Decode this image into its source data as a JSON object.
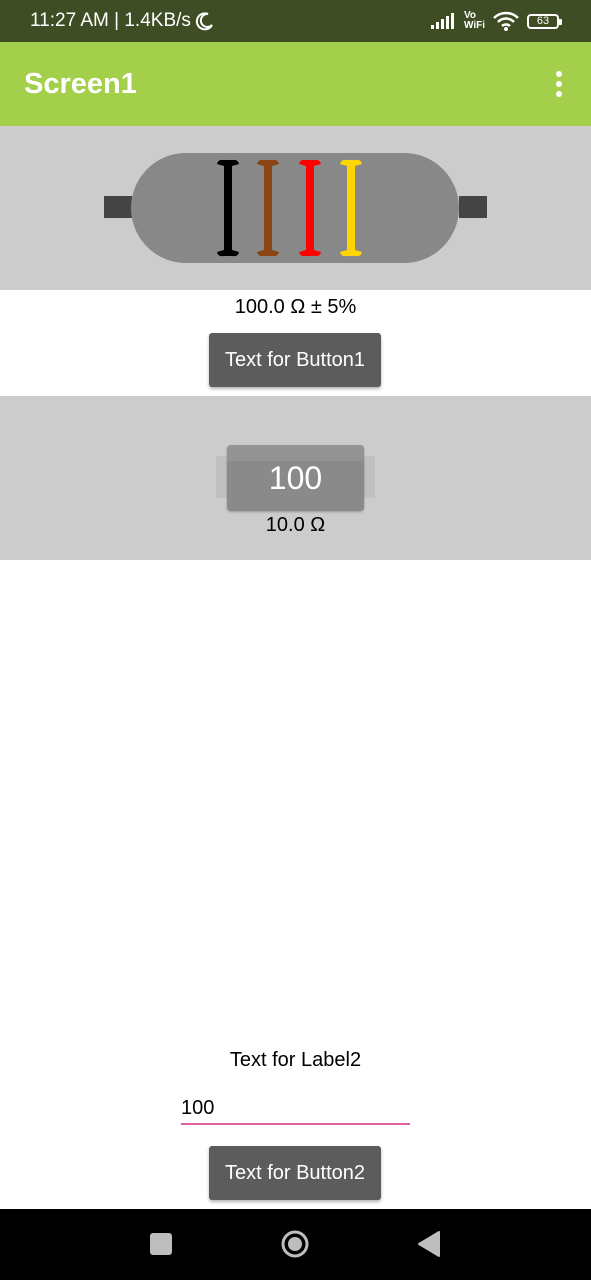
{
  "status_bar": {
    "time_speed": "11:27 AM | 1.4KB/s",
    "vo": "Vo",
    "wifi_label": "WiFi",
    "battery": "63",
    "icons": [
      "moon-icon",
      "signal-icon",
      "wifi-icon",
      "battery-icon"
    ]
  },
  "app_bar": {
    "title": "Screen1",
    "menu_icon": "more-vert-icon"
  },
  "resistor": {
    "band_colors": [
      "#000000",
      "#8b4513",
      "#ff0000",
      "#ffd700"
    ],
    "body_color": "#888888",
    "value_label": "100.0 Ω ± 5%"
  },
  "button1": {
    "label": "Text for Button1"
  },
  "picker": {
    "value": "100",
    "label": "10.0 Ω"
  },
  "label2": {
    "text": "Text for Label2"
  },
  "textbox": {
    "value": "100"
  },
  "button2": {
    "label": "Text for Button2"
  },
  "nav_bar": {
    "icons": [
      "recents-icon",
      "home-icon",
      "back-icon"
    ]
  },
  "colors": {
    "app_bar": "#a4cf4a",
    "status_bar": "#3f4d24",
    "panel": "#cccccc",
    "button": "#5c5c5c",
    "underline": "#e0609c"
  }
}
